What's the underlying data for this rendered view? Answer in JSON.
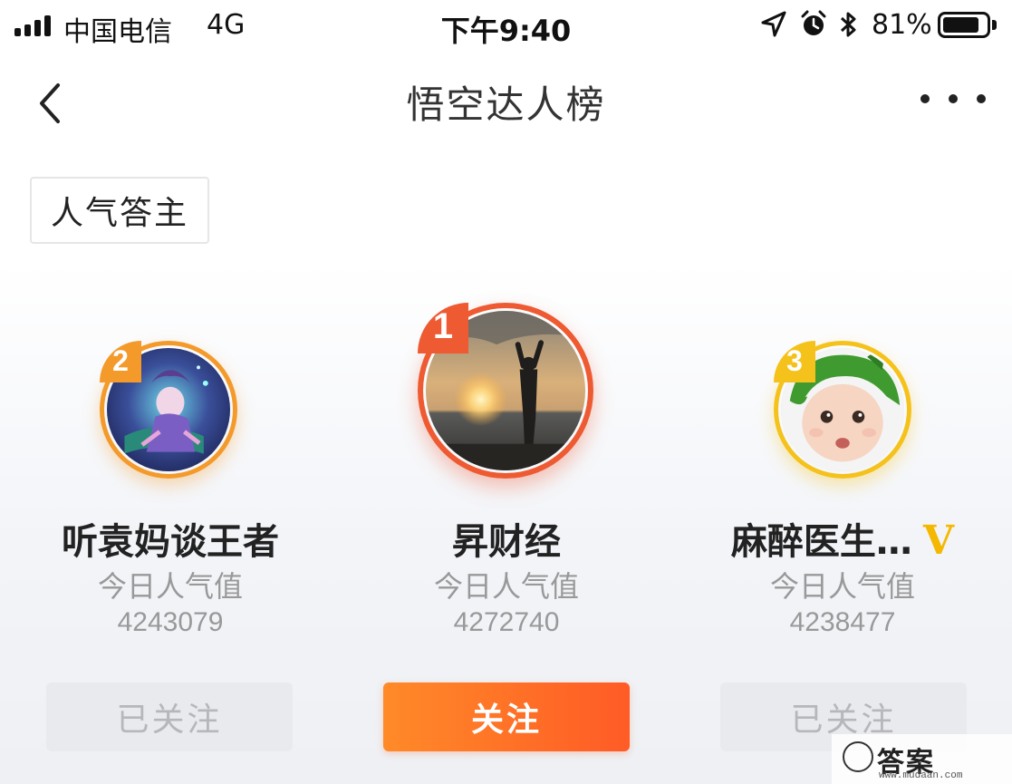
{
  "status_bar": {
    "carrier": "中国电信",
    "network": "4G",
    "time": "下午9:40",
    "battery_percent": "81%",
    "icons": [
      "signal-icon",
      "location-arrow-icon",
      "alarm-icon",
      "bluetooth-icon",
      "battery-icon"
    ]
  },
  "nav": {
    "title": "悟空达人榜",
    "back_icon": "back-chevron-icon",
    "more_icon": "more-dots-icon"
  },
  "category": {
    "label": "人气答主"
  },
  "rankings": [
    {
      "rank": "2",
      "name": "听袁妈谈王者",
      "verified": false,
      "popularity_label": "今日人气值",
      "popularity_value": "4243079",
      "follow_label": "已关注",
      "followed": true,
      "badge_color": "#f39a2b"
    },
    {
      "rank": "1",
      "name": "昇财经",
      "verified": false,
      "popularity_label": "今日人气值",
      "popularity_value": "4272740",
      "follow_label": "关注",
      "followed": false,
      "badge_color": "#ee5a32"
    },
    {
      "rank": "3",
      "name": "麻醉医生…",
      "verified": true,
      "verified_mark": "V",
      "popularity_label": "今日人气值",
      "popularity_value": "4238477",
      "follow_label": "已关注",
      "followed": true,
      "badge_color": "#f5c21b"
    }
  ],
  "colors": {
    "accent": "#ff6a26",
    "followed_bg": "#e9eaee",
    "rank1": "#ee5a32",
    "rank2": "#f39a2b",
    "rank3": "#f5c21b"
  },
  "watermark": {
    "text": "答案",
    "url": "www.mudaan.com"
  }
}
